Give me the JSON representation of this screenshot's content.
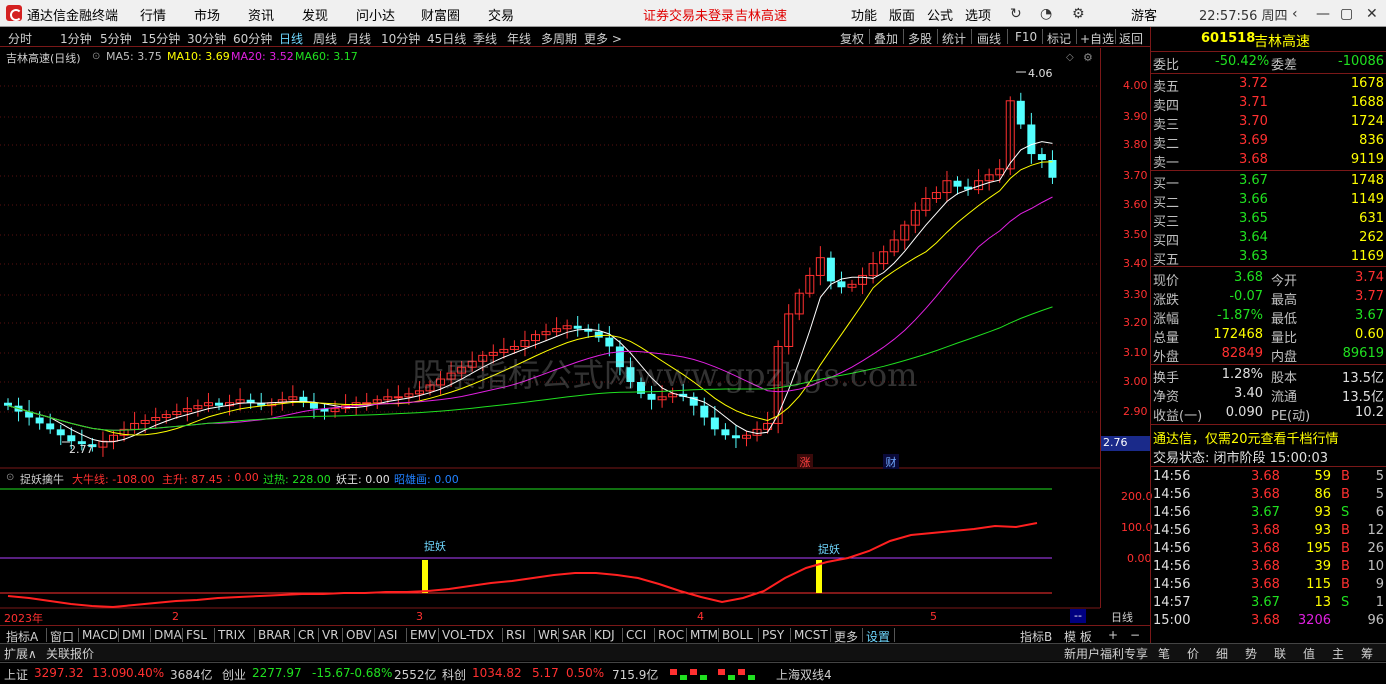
{
  "menubar": {
    "app_title": "通达信金融终端",
    "menus": [
      "行情",
      "市场",
      "资讯",
      "发现",
      "问小达",
      "财富圈",
      "交易"
    ],
    "notice": "证券交易未登录",
    "notice_stock": "吉林高速",
    "right_menus": [
      "功能",
      "版面",
      "公式",
      "选项"
    ],
    "user": "游客",
    "clock": "22:57:56 周四"
  },
  "toolbar": {
    "periods": [
      "分时",
      "1分钟",
      "5分钟",
      "15分钟",
      "30分钟",
      "60分钟",
      "日线",
      "周线",
      "月线",
      "10分钟",
      "45日线",
      "季线",
      "年线",
      "多周期",
      "更多 >"
    ],
    "active_period": "日线",
    "actions": [
      "复权",
      "叠加",
      "多股",
      "统计",
      "画线",
      "F10",
      "标记",
      "+自选",
      "返回"
    ]
  },
  "kline": {
    "title": "吉林高速(日线)",
    "ma_labels": [
      {
        "text": "MA5: 3.75",
        "color": "#ffffff"
      },
      {
        "text": "MA10: 3.69",
        "color": "#ffff00"
      },
      {
        "text": "MA20: 3.52",
        "color": "#e020e0"
      },
      {
        "text": "MA60: 3.17",
        "color": "#20e020"
      }
    ],
    "high_mark": "4.06",
    "low_mark": "2.77",
    "watermark": "股票指标公式网www.gpzbgs.com",
    "event_zhang": "涨",
    "event_cai": "财",
    "y_ticks": [
      "4.00",
      "3.90",
      "3.80",
      "3.70",
      "3.60",
      "3.50",
      "3.40",
      "3.30",
      "3.20",
      "3.10",
      "3.00",
      "2.90"
    ],
    "cursor_price": "2.76",
    "y_min": 2.76,
    "y_max": 4.06
  },
  "indicator": {
    "name": "捉妖擒牛",
    "items": [
      {
        "text": "大牛线: -108.00",
        "color": "#ff3030"
      },
      {
        "text": "主升: 87.45",
        "color": "#ff3030"
      },
      {
        "text": ": 0.00",
        "color": "#ff3030"
      },
      {
        "text": "过热: 228.00",
        "color": "#20e020"
      },
      {
        "text": "妖王: 0.00",
        "color": "#e0e0e0"
      },
      {
        "text": "昭雄画: 0.00",
        "color": "#2080ff"
      }
    ],
    "y_ticks": [
      "200.0",
      "100.0",
      "0.00"
    ],
    "signal_label": "捉妖",
    "timeline": [
      "2023年",
      "2",
      "3",
      "4",
      "5"
    ],
    "period_button": "日线"
  },
  "indicator_tabs": [
    "指标A",
    "窗口",
    "MACD",
    "DMI",
    "DMA",
    "FSL",
    "TRIX",
    "BRAR",
    "CR",
    "VR",
    "OBV",
    "ASI",
    "EMV",
    "VOL-TDX",
    "RSI",
    "WR",
    "SAR",
    "KDJ",
    "CCI",
    "ROC",
    "MTM",
    "BOLL",
    "PSY",
    "MCST",
    "更多",
    "设置"
  ],
  "indicator_tabs_right": [
    "指标B",
    "模 板",
    "+",
    "−"
  ],
  "quote": {
    "code": "601518",
    "name": "吉林高速",
    "weibi_label": "委比",
    "weibi": "-50.42%",
    "weicha_label": "委差",
    "weicha": "-10086",
    "sells": [
      {
        "label": "卖五",
        "price": "3.72",
        "vol": "1678"
      },
      {
        "label": "卖四",
        "price": "3.71",
        "vol": "1688"
      },
      {
        "label": "卖三",
        "price": "3.70",
        "vol": "1724"
      },
      {
        "label": "卖二",
        "price": "3.69",
        "vol": "836"
      },
      {
        "label": "卖一",
        "price": "3.68",
        "vol": "9119"
      }
    ],
    "buys": [
      {
        "label": "买一",
        "price": "3.67",
        "vol": "1748"
      },
      {
        "label": "买二",
        "price": "3.66",
        "vol": "1149"
      },
      {
        "label": "买三",
        "price": "3.65",
        "vol": "631"
      },
      {
        "label": "买四",
        "price": "3.64",
        "vol": "262"
      },
      {
        "label": "买五",
        "price": "3.63",
        "vol": "1169"
      }
    ],
    "stats": [
      {
        "l1": "现价",
        "v1": "3.68",
        "c1": "#20e020",
        "l2": "今开",
        "v2": "3.74",
        "c2": "#ff3030"
      },
      {
        "l1": "涨跌",
        "v1": "-0.07",
        "c1": "#20e020",
        "l2": "最高",
        "v2": "3.77",
        "c2": "#ff3030"
      },
      {
        "l1": "涨幅",
        "v1": "-1.87%",
        "c1": "#20e020",
        "l2": "最低",
        "v2": "3.67",
        "c2": "#20e020"
      },
      {
        "l1": "总量",
        "v1": "172468",
        "c1": "#ffff00",
        "l2": "量比",
        "v2": "0.60",
        "c2": "#ffff00"
      },
      {
        "l1": "外盘",
        "v1": "82849",
        "c1": "#ff3030",
        "l2": "内盘",
        "v2": "89619",
        "c2": "#20e020"
      }
    ],
    "fin": [
      {
        "l1": "换手",
        "v1": "1.28%",
        "l2": "股本",
        "v2": "13.5亿"
      },
      {
        "l1": "净资",
        "v1": "3.40",
        "l2": "流通",
        "v2": "13.5亿"
      },
      {
        "l1": "收益(一)",
        "v1": "0.090",
        "l2": "PE(动)",
        "v2": "10.2"
      }
    ],
    "promo": "通达信，仅需20元查看千档行情",
    "trade_status": "交易状态: 闭市阶段 15:00:03",
    "ticks": [
      {
        "t": "14:56",
        "p": "3.68",
        "v": "59",
        "s": "B",
        "n": "5"
      },
      {
        "t": "14:56",
        "p": "3.68",
        "v": "86",
        "s": "B",
        "n": "5"
      },
      {
        "t": "14:56",
        "p": "3.67",
        "v": "93",
        "s": "S",
        "n": "6"
      },
      {
        "t": "14:56",
        "p": "3.68",
        "v": "93",
        "s": "B",
        "n": "12"
      },
      {
        "t": "14:56",
        "p": "3.68",
        "v": "195",
        "s": "B",
        "n": "26"
      },
      {
        "t": "14:56",
        "p": "3.68",
        "v": "39",
        "s": "B",
        "n": "10"
      },
      {
        "t": "14:56",
        "p": "3.68",
        "v": "115",
        "s": "B",
        "n": "9"
      },
      {
        "t": "14:57",
        "p": "3.67",
        "v": "13",
        "s": "S",
        "n": "1"
      },
      {
        "t": "15:00",
        "p": "3.68",
        "v": "3206",
        "s": "",
        "n": "96"
      }
    ]
  },
  "statusbar": {
    "expand": "扩展∧",
    "link": "关联报价",
    "indices": [
      {
        "name": "上证",
        "value": "3297.32",
        "chg": "13.09",
        "pct": "0.40%",
        "amt": "3684亿",
        "color": "#ff3030"
      },
      {
        "name": "创业",
        "value": "2277.97",
        "chg": "-15.67",
        "pct": "-0.68%",
        "amt": "2552亿",
        "color": "#20e020"
      },
      {
        "name": "科创",
        "value": "1034.82",
        "chg": "5.17",
        "pct": "0.50%",
        "amt": "715.9亿",
        "color": "#ff3030"
      }
    ],
    "market_name": "上海双线4",
    "right_tabs": [
      "笔",
      "价",
      "细",
      "势",
      "联",
      "值",
      "主",
      "筹"
    ],
    "promo": "新用户福利专享"
  }
}
